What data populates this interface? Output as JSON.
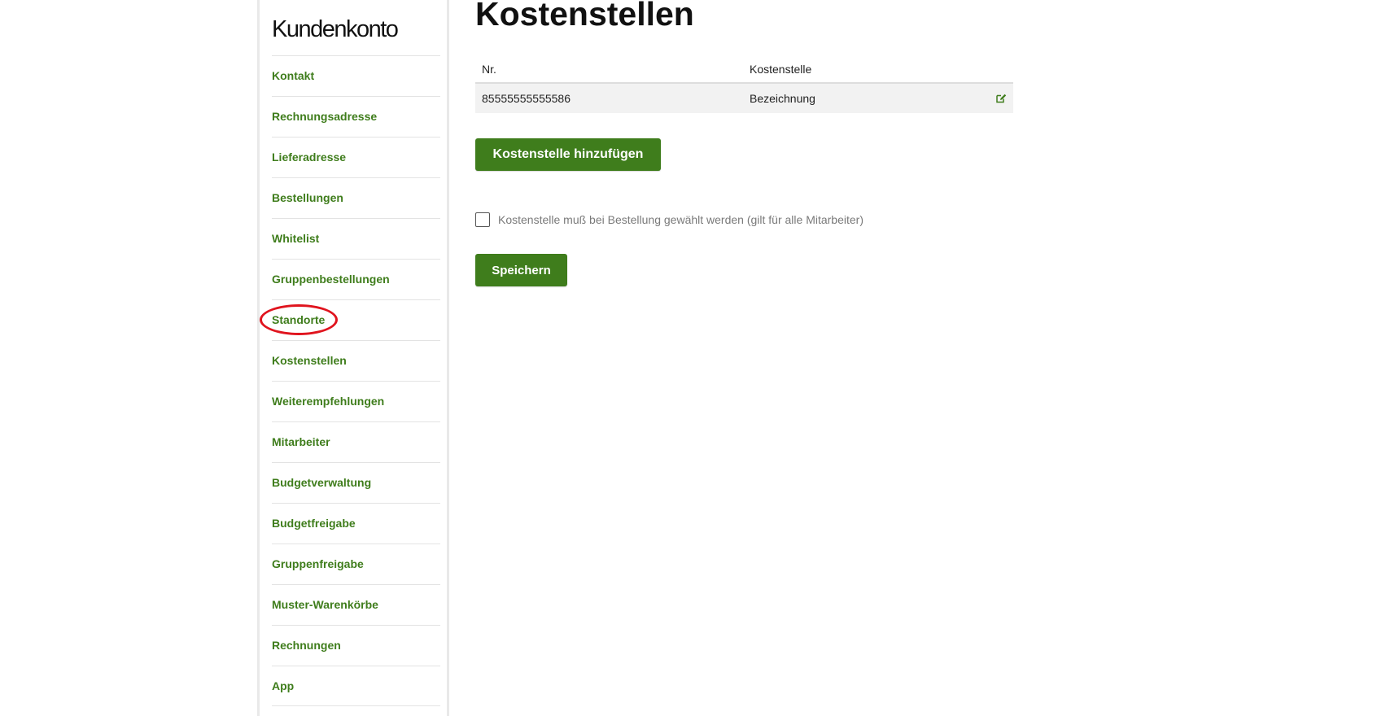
{
  "sidebar": {
    "title": "Kundenkonto",
    "items": [
      {
        "label": "Kontakt"
      },
      {
        "label": "Rechnungsadresse"
      },
      {
        "label": "Lieferadresse"
      },
      {
        "label": "Bestellungen"
      },
      {
        "label": "Whitelist"
      },
      {
        "label": "Gruppenbestellungen"
      },
      {
        "label": "Standorte",
        "highlighted": true
      },
      {
        "label": "Kostenstellen"
      },
      {
        "label": "Weiterempfehlungen"
      },
      {
        "label": "Mitarbeiter"
      },
      {
        "label": "Budgetverwaltung"
      },
      {
        "label": "Budgetfreigabe"
      },
      {
        "label": "Gruppenfreigabe"
      },
      {
        "label": "Muster-Warenkörbe"
      },
      {
        "label": "Rechnungen"
      },
      {
        "label": "App"
      }
    ]
  },
  "main": {
    "title": "Kostenstellen",
    "table": {
      "headers": [
        "Nr.",
        "Kostenstelle"
      ],
      "rows": [
        {
          "nr": "85555555555586",
          "kostenstelle": "Bezeichnung",
          "action_icon": "edit-icon"
        }
      ]
    },
    "add_button_label": "Kostenstelle hinzufügen",
    "checkbox": {
      "label": "Kostenstelle muß bei Bestellung gewählt werden (gilt für alle Mitarbeiter)",
      "checked": false
    },
    "save_button_label": "Speichern"
  },
  "colors": {
    "accent": "#3f7d1c",
    "highlight_ring": "#e0141e",
    "row_background": "#f2f2f2"
  }
}
